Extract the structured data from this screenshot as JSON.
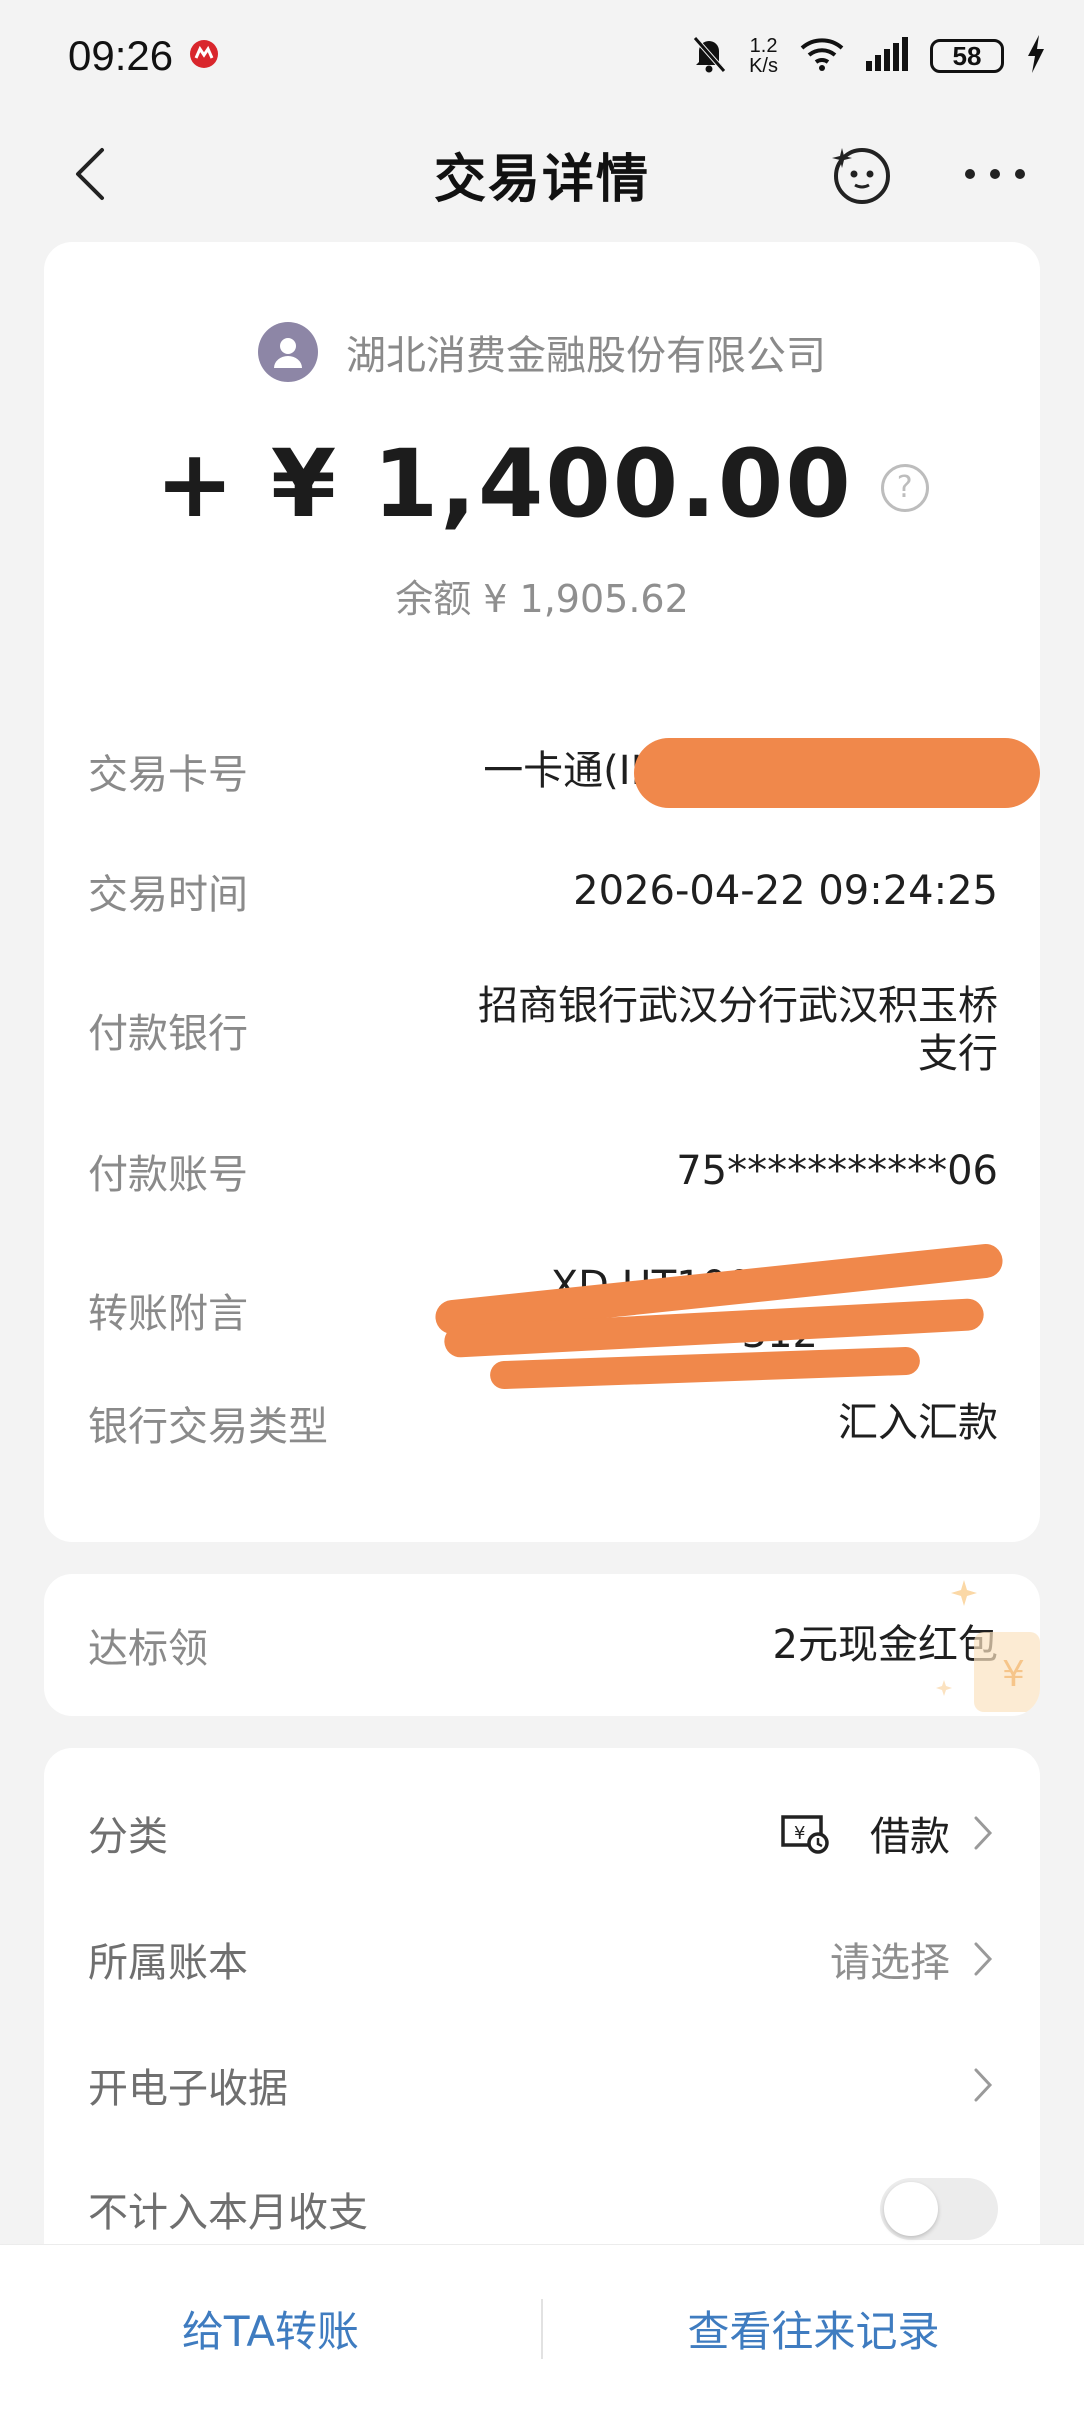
{
  "status_bar": {
    "time": "09:26",
    "net_speed_value": "1.2",
    "net_speed_unit": "K/s",
    "battery": "58",
    "icons": [
      "cmb-app-icon",
      "bell-muted-icon",
      "wifi-icon",
      "signal-icon",
      "charging-icon"
    ]
  },
  "header": {
    "title": "交易详情"
  },
  "transaction": {
    "payer": "湖北消费金融股份有限公司",
    "amount": "+ ¥ 1,400.00",
    "balance": "余额 ¥ 1,905.62",
    "details": [
      {
        "label": "交易卡号",
        "value": "一卡通(II类)"
      },
      {
        "label": "交易时间",
        "value": "2026-04-22 09:24:25"
      },
      {
        "label": "付款银行",
        "value_line1": "招商银行武汉分行武汉积玉桥",
        "value_line2": "支行"
      },
      {
        "label": "付款账号",
        "value": "75***********06"
      },
      {
        "label": "转账附言",
        "value_line1": "XD HT1005",
        "value_line2": "312"
      },
      {
        "label": "银行交易类型",
        "value": "汇入汇款"
      }
    ]
  },
  "promo": {
    "label": "达标领",
    "value": "2元现金红包"
  },
  "settings": {
    "category_label": "分类",
    "category_value": "借款",
    "ledger_label": "所属账本",
    "ledger_placeholder": "请选择",
    "receipt_label": "开电子收据",
    "exclude_label": "不计入本月收支",
    "exclude_on": false
  },
  "bottom_bar": {
    "transfer_label": "给TA转账",
    "history_label": "查看往来记录"
  },
  "colors": {
    "accent": "#3f7cc0",
    "redaction": "#f0884b",
    "background": "#f3f3f3"
  }
}
